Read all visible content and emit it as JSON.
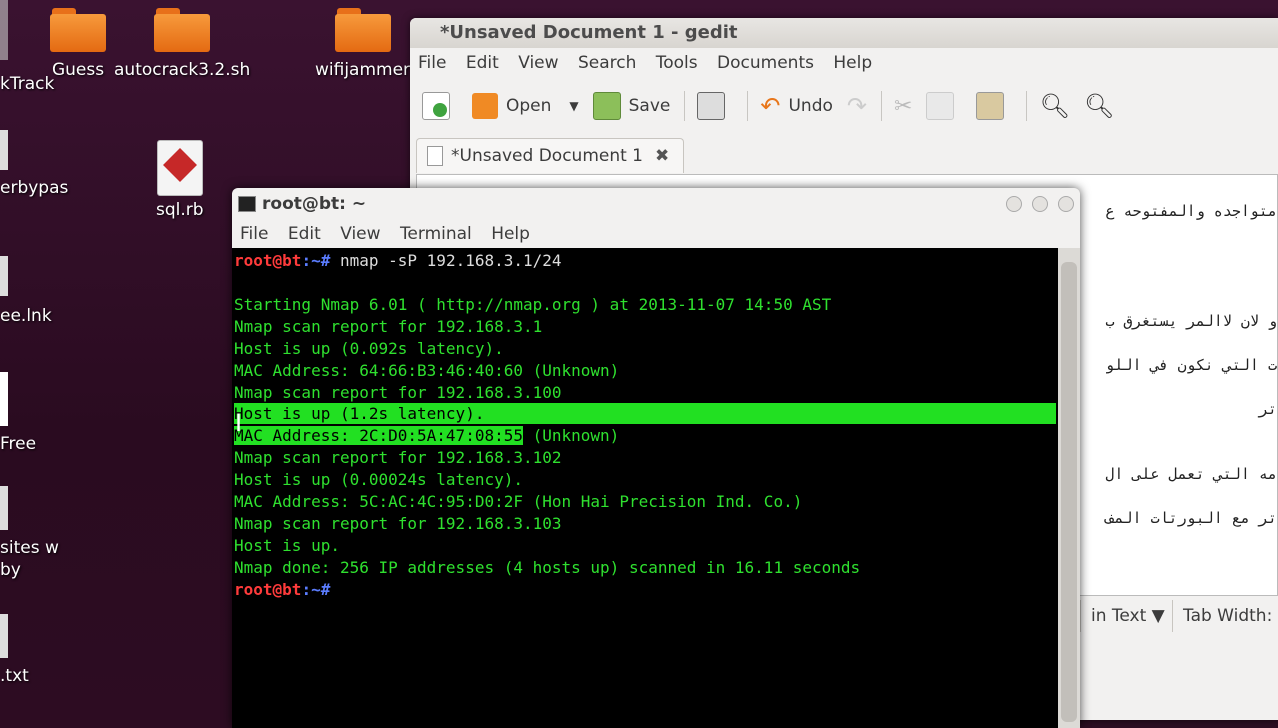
{
  "desktop": {
    "icons": [
      {
        "label": "Guess"
      },
      {
        "label": "autocrack3.2.sh"
      },
      {
        "label": "wifijammer"
      },
      {
        "label": "sql.rb"
      }
    ],
    "side_labels": [
      "kTrack",
      "erbypas",
      "ee.lnk",
      "Free",
      "sites w",
      "by",
      ".txt"
    ]
  },
  "gedit": {
    "title": "*Unsaved Document 1 - gedit",
    "menu": [
      "File",
      "Edit",
      "View",
      "Search",
      "Tools",
      "Documents",
      "Help"
    ],
    "toolbar": {
      "open": "Open",
      "save": "Save",
      "undo": "Undo"
    },
    "tab_label": "*Unsaved Document 1",
    "text_lines": [
      "متواجده والمفتوحه ع",
      "و لان لاالمر يستغرق ب",
      "ت التي نكون في اللو",
      "تر",
      "مه التي تعمل على ال",
      "تر مع البورتات المف"
    ],
    "status": {
      "highlight": "in Text ▼",
      "tab_width": "Tab Width:"
    }
  },
  "terminal": {
    "title": "root@bt: ~",
    "menu": [
      "File",
      "Edit",
      "View",
      "Terminal",
      "Help"
    ],
    "prompt_user": "root@bt",
    "prompt_path": ":~#",
    "command": " nmap -sP 192.168.3.1/24",
    "lines": [
      "Starting Nmap 6.01 ( http://nmap.org ) at 2013-11-07 14:50 AST",
      "Nmap scan report for 192.168.3.1",
      "Host is up (0.092s latency).",
      "MAC Address: 64:66:B3:46:40:60 (Unknown)",
      "Nmap scan report for 192.168.3.100",
      "Host is up (1.2s latency).",
      "MAC Address: 2C:D0:5A:47:08:55",
      " (Unknown)",
      "Nmap scan report for 192.168.3.102",
      "Host is up (0.00024s latency).",
      "MAC Address: 5C:AC:4C:95:D0:2F (Hon Hai Precision Ind. Co.)",
      "Nmap scan report for 192.168.3.103",
      "Host is up.",
      "Nmap done: 256 IP addresses (4 hosts up) scanned in 16.11 seconds"
    ]
  }
}
